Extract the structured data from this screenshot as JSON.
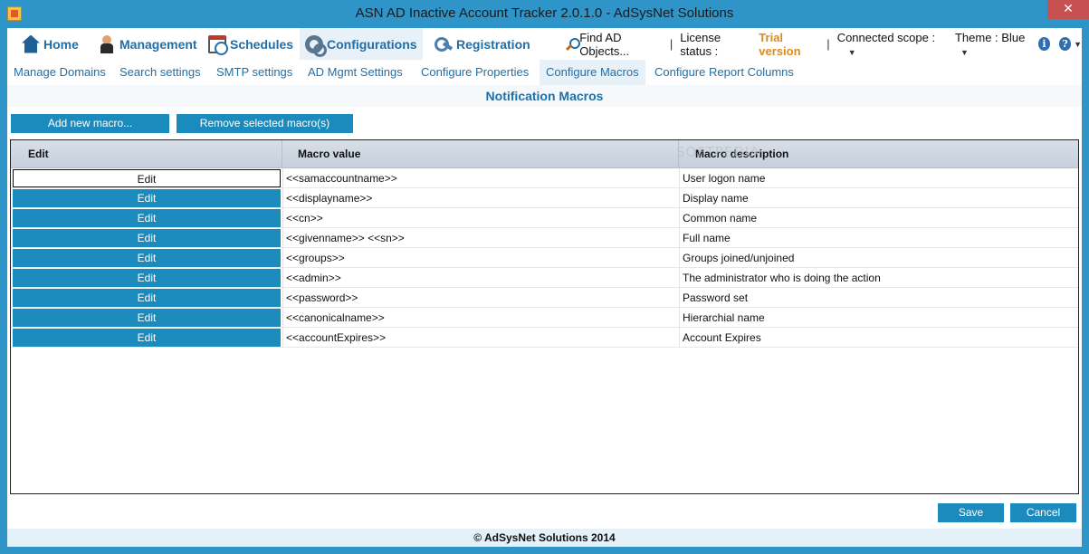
{
  "window": {
    "title": "ASN AD Inactive Account Tracker 2.0.1.0 - AdSysNet Solutions",
    "close_glyph": "✕"
  },
  "menu": {
    "items": [
      {
        "label": "Home",
        "icon": "home-icon"
      },
      {
        "label": "Management",
        "icon": "user-icon"
      },
      {
        "label": "Schedules",
        "icon": "calendar-clock-icon"
      },
      {
        "label": "Configurations",
        "icon": "gears-icon"
      },
      {
        "label": "Registration",
        "icon": "key-icon"
      }
    ],
    "active": "Configurations"
  },
  "topright": {
    "find_label": "Find AD Objects...",
    "license_label": "License status :",
    "license_value": "Trial version",
    "scope_label": "Connected scope :",
    "theme_label": "Theme : Blue",
    "info_glyph": "i",
    "help_glyph": "?"
  },
  "subtabs": {
    "items": [
      "Manage Domains",
      "Search settings",
      "SMTP settings",
      "AD Mgmt Settings",
      "Configure Properties",
      "Configure Macros",
      "Configure Report Columns"
    ],
    "active": "Configure Macros"
  },
  "page": {
    "subtitle": "Notification Macros"
  },
  "toolbar": {
    "add_label": "Add new macro...",
    "remove_label": "Remove selected macro(s)"
  },
  "grid": {
    "columns": [
      "Edit",
      "Macro value",
      "Macro description"
    ],
    "watermark": "SOFTPEDIA",
    "edit_label": "Edit",
    "rows": [
      {
        "value": "<<samaccountname>>",
        "description": "User logon name"
      },
      {
        "value": "<<displayname>>",
        "description": "Display name"
      },
      {
        "value": "<<cn>>",
        "description": "Common name"
      },
      {
        "value": "<<givenname>> <<sn>>",
        "description": "Full name"
      },
      {
        "value": "<<groups>>",
        "description": "Groups joined/unjoined"
      },
      {
        "value": "<<admin>>",
        "description": "The administrator who is doing the action"
      },
      {
        "value": "<<password>>",
        "description": "Password set"
      },
      {
        "value": "<<canonicalname>>",
        "description": "Hierarchial name"
      },
      {
        "value": "<<accountExpires>>",
        "description": "Account Expires"
      }
    ],
    "selected_row": 0
  },
  "actions": {
    "save_label": "Save",
    "cancel_label": "Cancel"
  },
  "footer": {
    "text": "© AdSysNet Solutions 2014"
  },
  "colors": {
    "accent": "#1b8bbd",
    "link": "#1f6fa8",
    "trial": "#d98a1e",
    "chrome": "#2f94c8"
  }
}
